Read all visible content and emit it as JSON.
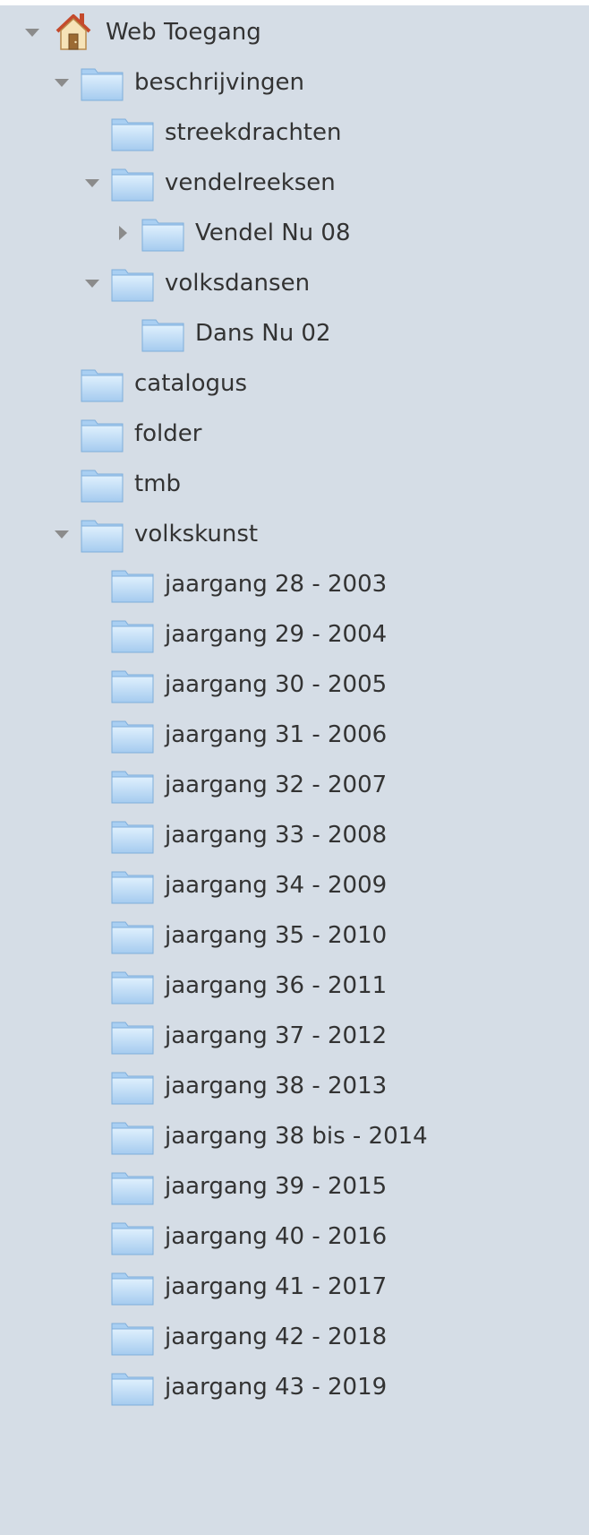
{
  "tree": {
    "root": {
      "label": "Web Toegang",
      "icon": "home-icon",
      "expanded": true
    },
    "beschrijvingen": {
      "label": "beschrijvingen",
      "expanded": true
    },
    "streekdrachten": {
      "label": "streekdrachten"
    },
    "vendelreeksen": {
      "label": "vendelreeksen",
      "expanded": true
    },
    "vendel_nu_08": {
      "label": "Vendel Nu 08",
      "expanded": false
    },
    "volksdansen": {
      "label": "volksdansen",
      "expanded": true
    },
    "dans_nu_02": {
      "label": "Dans Nu 02"
    },
    "catalogus": {
      "label": "catalogus"
    },
    "folder": {
      "label": "folder"
    },
    "tmb": {
      "label": "tmb"
    },
    "volkskunst": {
      "label": "volkskunst",
      "expanded": true
    },
    "jaargangen": [
      "jaargang 28 - 2003",
      "jaargang 29 - 2004",
      "jaargang 30 - 2005",
      "jaargang 31 - 2006",
      "jaargang 32 - 2007",
      "jaargang 33 - 2008",
      "jaargang 34 - 2009",
      "jaargang 35 - 2010",
      "jaargang 36 - 2011",
      "jaargang 37 - 2012",
      "jaargang 38 - 2013",
      "jaargang 38 bis - 2014",
      "jaargang 39 - 2015",
      "jaargang 40 - 2016",
      "jaargang 41 - 2017",
      "jaargang 42 - 2018",
      "jaargang 43 - 2019"
    ]
  },
  "colors": {
    "panel_background": "#d5dde6",
    "text": "#333333",
    "twisty": "#8b8b8b",
    "folder_light": "#d9ecfc",
    "folder_dark": "#9dc6ec",
    "folder_edge": "#7eaedb"
  }
}
